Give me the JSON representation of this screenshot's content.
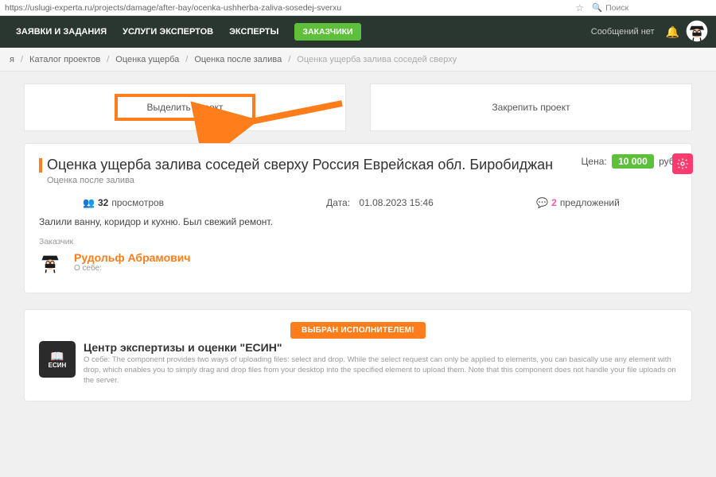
{
  "browser": {
    "url": "https://uslugi-experta.ru/projects/damage/after-bay/ocenka-ushherba-zaliva-sosedej-sverxu",
    "search_placeholder": "Поиск"
  },
  "nav": {
    "items": [
      "ЗАЯВКИ И ЗАДАНИЯ",
      "УСЛУГИ ЭКСПЕРТОВ",
      "ЭКСПЕРТЫ"
    ],
    "badge": "ЗАКАЗЧИКИ",
    "messages": "Сообщений нет"
  },
  "breadcrumb": {
    "items": [
      "я",
      "Каталог проектов",
      "Оценка ущерба",
      "Оценка после залива"
    ],
    "current": "Оценка ущерба залива соседей сверху"
  },
  "actions": {
    "highlight": "Выделить проект",
    "pin": "Закрепить проект"
  },
  "project": {
    "title": "Оценка ущерба залива соседей сверху Россия Еврейская обл. Биробиджан",
    "subtitle": "Оценка после залива",
    "price_label": "Цена:",
    "price_value": "10 000",
    "price_suffix": "руб.",
    "views_count": "32",
    "views_label": "просмотров",
    "date_label": "Дата:",
    "date_value": "01.08.2023 15:46",
    "offers_count": "2",
    "offers_label": "предложений",
    "description": "Залили ванну, коридор и кухню. Был свежий ремонт.",
    "customer_heading": "Заказчик",
    "customer_name": "Рудольф Абрамович",
    "customer_about_label": "О себе:"
  },
  "executor": {
    "badge": "ВЫБРАН ИСПОЛНИТЕЛЕМ!",
    "name": "Центр экспертизы и оценки \"ЕСИН\"",
    "logo_text": "ЕСИН",
    "about": "О себе: The component provides two ways of uploading files: select and drop. While the select request can only be applied to elements, you can basically use any element with drop, which enables you to simply drag and drop files from your desktop into the specified element to upload them. Note that this component does not handle your file uploads on the server."
  }
}
